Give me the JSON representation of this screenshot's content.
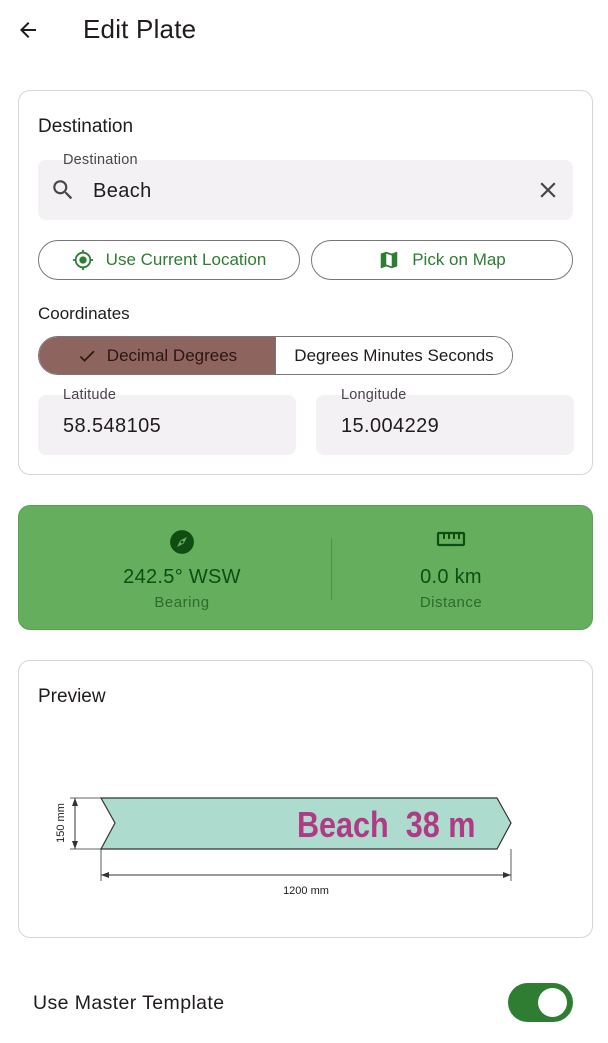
{
  "appbar": {
    "title": "Edit Plate"
  },
  "destination_card": {
    "title": "Destination",
    "field": {
      "label": "Destination",
      "value": "Beach"
    },
    "use_location_label": "Use Current Location",
    "pick_map_label": "Pick on Map",
    "coordinates_title": "Coordinates",
    "format_options": [
      "Decimal Degrees",
      "Degrees Minutes Seconds"
    ],
    "selected_format": "Decimal Degrees",
    "latitude": {
      "label": "Latitude",
      "value": "58.548105"
    },
    "longitude": {
      "label": "Longitude",
      "value": "15.004229"
    }
  },
  "stats": {
    "bearing": {
      "value": "242.5° WSW",
      "label": "Bearing"
    },
    "distance": {
      "value": "0.0 km",
      "label": "Distance"
    }
  },
  "preview": {
    "title": "Preview",
    "plate_text": "Beach  38 m",
    "height_dim": "150 mm",
    "width_dim": "1200 mm"
  },
  "master_template": {
    "label": "Use Master Template",
    "enabled": true
  },
  "colors": {
    "accent_green": "#2e7d32",
    "stats_bg": "#64ae5e",
    "segment_selected": "#8d655e",
    "plate_fill": "#addccf",
    "plate_text": "#b03a83"
  }
}
